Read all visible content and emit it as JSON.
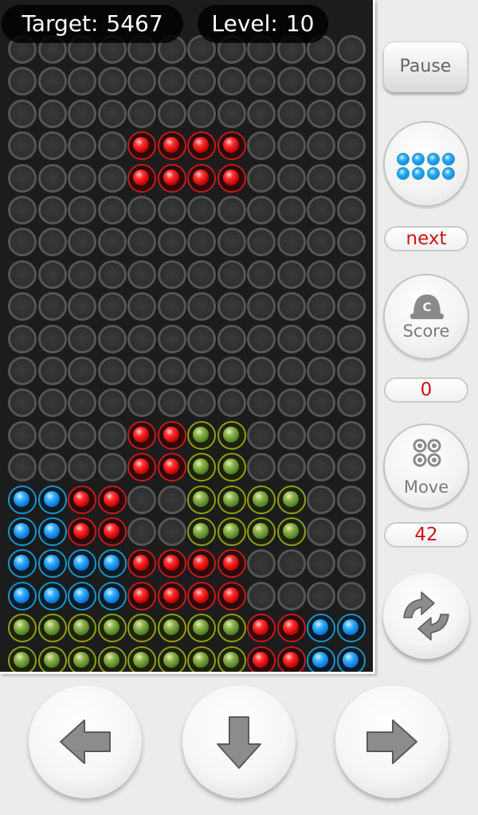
{
  "hud": {
    "target_label": "Target:",
    "target_value": "5467",
    "level_label": "Level:",
    "level_value": "10"
  },
  "board": {
    "cols": 12,
    "rows": 20,
    "filled": [
      {
        "row": 3,
        "col": 4,
        "color": "red"
      },
      {
        "row": 3,
        "col": 5,
        "color": "red"
      },
      {
        "row": 3,
        "col": 6,
        "color": "red"
      },
      {
        "row": 3,
        "col": 7,
        "color": "red"
      },
      {
        "row": 4,
        "col": 4,
        "color": "red"
      },
      {
        "row": 4,
        "col": 5,
        "color": "red"
      },
      {
        "row": 4,
        "col": 6,
        "color": "red"
      },
      {
        "row": 4,
        "col": 7,
        "color": "red"
      },
      {
        "row": 12,
        "col": 4,
        "color": "red"
      },
      {
        "row": 12,
        "col": 5,
        "color": "red"
      },
      {
        "row": 12,
        "col": 6,
        "color": "green"
      },
      {
        "row": 12,
        "col": 7,
        "color": "green"
      },
      {
        "row": 13,
        "col": 4,
        "color": "red"
      },
      {
        "row": 13,
        "col": 5,
        "color": "red"
      },
      {
        "row": 13,
        "col": 6,
        "color": "green"
      },
      {
        "row": 13,
        "col": 7,
        "color": "green"
      },
      {
        "row": 14,
        "col": 0,
        "color": "blue"
      },
      {
        "row": 14,
        "col": 1,
        "color": "blue"
      },
      {
        "row": 14,
        "col": 2,
        "color": "red"
      },
      {
        "row": 14,
        "col": 3,
        "color": "red"
      },
      {
        "row": 14,
        "col": 6,
        "color": "green"
      },
      {
        "row": 14,
        "col": 7,
        "color": "green"
      },
      {
        "row": 14,
        "col": 8,
        "color": "green"
      },
      {
        "row": 14,
        "col": 9,
        "color": "green"
      },
      {
        "row": 15,
        "col": 0,
        "color": "blue"
      },
      {
        "row": 15,
        "col": 1,
        "color": "blue"
      },
      {
        "row": 15,
        "col": 2,
        "color": "red"
      },
      {
        "row": 15,
        "col": 3,
        "color": "red"
      },
      {
        "row": 15,
        "col": 6,
        "color": "green"
      },
      {
        "row": 15,
        "col": 7,
        "color": "green"
      },
      {
        "row": 15,
        "col": 8,
        "color": "green"
      },
      {
        "row": 15,
        "col": 9,
        "color": "green"
      },
      {
        "row": 16,
        "col": 0,
        "color": "blue"
      },
      {
        "row": 16,
        "col": 1,
        "color": "blue"
      },
      {
        "row": 16,
        "col": 2,
        "color": "blue"
      },
      {
        "row": 16,
        "col": 3,
        "color": "blue"
      },
      {
        "row": 16,
        "col": 4,
        "color": "red"
      },
      {
        "row": 16,
        "col": 5,
        "color": "red"
      },
      {
        "row": 16,
        "col": 6,
        "color": "red"
      },
      {
        "row": 16,
        "col": 7,
        "color": "red"
      },
      {
        "row": 17,
        "col": 0,
        "color": "blue"
      },
      {
        "row": 17,
        "col": 1,
        "color": "blue"
      },
      {
        "row": 17,
        "col": 2,
        "color": "blue"
      },
      {
        "row": 17,
        "col": 3,
        "color": "blue"
      },
      {
        "row": 17,
        "col": 4,
        "color": "red"
      },
      {
        "row": 17,
        "col": 5,
        "color": "red"
      },
      {
        "row": 17,
        "col": 6,
        "color": "red"
      },
      {
        "row": 17,
        "col": 7,
        "color": "red"
      },
      {
        "row": 18,
        "col": 0,
        "color": "green"
      },
      {
        "row": 18,
        "col": 1,
        "color": "green"
      },
      {
        "row": 18,
        "col": 2,
        "color": "green"
      },
      {
        "row": 18,
        "col": 3,
        "color": "green"
      },
      {
        "row": 18,
        "col": 4,
        "color": "green"
      },
      {
        "row": 18,
        "col": 5,
        "color": "green"
      },
      {
        "row": 18,
        "col": 6,
        "color": "green"
      },
      {
        "row": 18,
        "col": 7,
        "color": "green"
      },
      {
        "row": 18,
        "col": 8,
        "color": "red"
      },
      {
        "row": 18,
        "col": 9,
        "color": "red"
      },
      {
        "row": 18,
        "col": 10,
        "color": "blue"
      },
      {
        "row": 18,
        "col": 11,
        "color": "blue"
      },
      {
        "row": 19,
        "col": 0,
        "color": "green"
      },
      {
        "row": 19,
        "col": 1,
        "color": "green"
      },
      {
        "row": 19,
        "col": 2,
        "color": "green"
      },
      {
        "row": 19,
        "col": 3,
        "color": "green"
      },
      {
        "row": 19,
        "col": 4,
        "color": "green"
      },
      {
        "row": 19,
        "col": 5,
        "color": "green"
      },
      {
        "row": 19,
        "col": 6,
        "color": "green"
      },
      {
        "row": 19,
        "col": 7,
        "color": "green"
      },
      {
        "row": 19,
        "col": 8,
        "color": "red"
      },
      {
        "row": 19,
        "col": 9,
        "color": "red"
      },
      {
        "row": 19,
        "col": 10,
        "color": "blue"
      },
      {
        "row": 19,
        "col": 11,
        "color": "blue"
      }
    ]
  },
  "side": {
    "pause_label": "Pause",
    "next_piece": {
      "color": "blue",
      "rows": 2,
      "cols": 4
    },
    "next_label": "next",
    "score_icon_letter": "C",
    "score_label": "Score",
    "score_value": "0",
    "move_label": "Move",
    "move_value": "42"
  },
  "icons": {
    "refresh": "rotate-arrows-icon",
    "left": "arrow-left-icon",
    "down": "arrow-down-icon",
    "right": "arrow-right-icon",
    "score": "cap-icon",
    "move": "four-dots-icon"
  },
  "colors": {
    "board_bg": "#1c1c1c",
    "panel_bg": "#ececec",
    "value_red": "#cc1414",
    "red_ball": "#ff3030",
    "green_ball": "#6f9a3a",
    "blue_ball": "#1ea0ff"
  }
}
